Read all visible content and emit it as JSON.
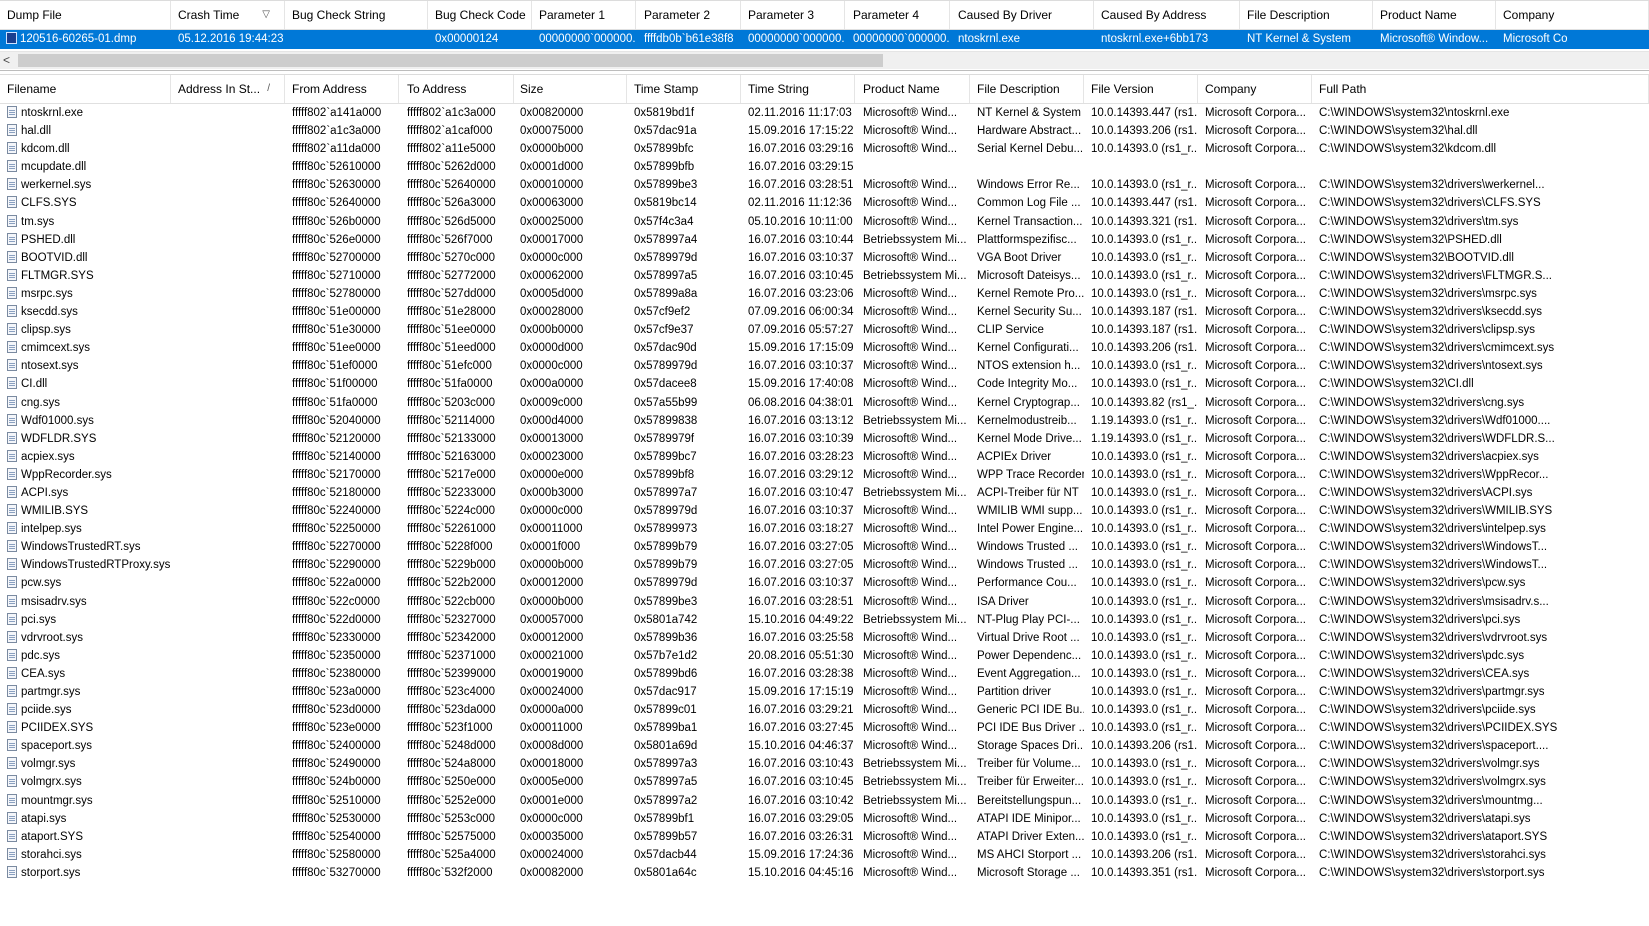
{
  "dump_columns": [
    "Dump File",
    "Crash Time",
    "Bug Check String",
    "Bug Check Code",
    "Parameter 1",
    "Parameter 2",
    "Parameter 3",
    "Parameter 4",
    "Caused By Driver",
    "Caused By Address",
    "File Description",
    "Product Name",
    "Company"
  ],
  "dump_sort_indicator": "▽",
  "dump_row": [
    "120516-60265-01.dmp",
    "05.12.2016 19:44:23",
    "",
    "0x00000124",
    "00000000`000000...",
    "ffffdb0b`b61e38f8",
    "00000000`000000...",
    "00000000`000000...",
    "ntoskrnl.exe",
    "ntoskrnl.exe+6bb173",
    "NT Kernel & System",
    "Microsoft® Window...",
    "Microsoft Co"
  ],
  "scroll_left_arrow": "<",
  "driver_columns": [
    "Filename",
    "Address In St...",
    "From Address",
    "To Address",
    "Size",
    "Time Stamp",
    "Time String",
    "Product Name",
    "File Description",
    "File Version",
    "Company",
    "Full Path"
  ],
  "driver_sort_indicator": "/",
  "drivers": [
    [
      "ntoskrnl.exe",
      "",
      "fffff802`a141a000",
      "fffff802`a1c3a000",
      "0x00820000",
      "0x5819bd1f",
      "02.11.2016 11:17:03",
      "Microsoft® Wind...",
      "NT Kernel & System",
      "10.0.14393.447 (rs1...",
      "Microsoft Corpora...",
      "C:\\WINDOWS\\system32\\ntoskrnl.exe"
    ],
    [
      "hal.dll",
      "",
      "fffff802`a1c3a000",
      "fffff802`a1caf000",
      "0x00075000",
      "0x57dac91a",
      "15.09.2016 17:15:22",
      "Microsoft® Wind...",
      "Hardware Abstract...",
      "10.0.14393.206 (rs1...",
      "Microsoft Corpora...",
      "C:\\WINDOWS\\system32\\hal.dll"
    ],
    [
      "kdcom.dll",
      "",
      "fffff802`a11da000",
      "fffff802`a11e5000",
      "0x0000b000",
      "0x57899bfc",
      "16.07.2016 03:29:16",
      "Microsoft® Wind...",
      "Serial Kernel Debu...",
      "10.0.14393.0 (rs1_r...",
      "Microsoft Corpora...",
      "C:\\WINDOWS\\system32\\kdcom.dll"
    ],
    [
      "mcupdate.dll",
      "",
      "fffff80c`52610000",
      "fffff80c`5262d000",
      "0x0001d000",
      "0x57899bfb",
      "16.07.2016 03:29:15",
      "",
      "",
      "",
      "",
      ""
    ],
    [
      "werkernel.sys",
      "",
      "fffff80c`52630000",
      "fffff80c`52640000",
      "0x00010000",
      "0x57899be3",
      "16.07.2016 03:28:51",
      "Microsoft® Wind...",
      "Windows Error Re...",
      "10.0.14393.0 (rs1_r...",
      "Microsoft Corpora...",
      "C:\\WINDOWS\\system32\\drivers\\werkernel..."
    ],
    [
      "CLFS.SYS",
      "",
      "fffff80c`52640000",
      "fffff80c`526a3000",
      "0x00063000",
      "0x5819bc14",
      "02.11.2016 11:12:36",
      "Microsoft® Wind...",
      "Common Log File ...",
      "10.0.14393.447 (rs1...",
      "Microsoft Corpora...",
      "C:\\WINDOWS\\system32\\drivers\\CLFS.SYS"
    ],
    [
      "tm.sys",
      "",
      "fffff80c`526b0000",
      "fffff80c`526d5000",
      "0x00025000",
      "0x57f4c3a4",
      "05.10.2016 10:11:00",
      "Microsoft® Wind...",
      "Kernel Transaction...",
      "10.0.14393.321 (rs1...",
      "Microsoft Corpora...",
      "C:\\WINDOWS\\system32\\drivers\\tm.sys"
    ],
    [
      "PSHED.dll",
      "",
      "fffff80c`526e0000",
      "fffff80c`526f7000",
      "0x00017000",
      "0x578997a4",
      "16.07.2016 03:10:44",
      "Betriebssystem Mi...",
      "Plattformspezifisc...",
      "10.0.14393.0 (rs1_r...",
      "Microsoft Corpora...",
      "C:\\WINDOWS\\system32\\PSHED.dll"
    ],
    [
      "BOOTVID.dll",
      "",
      "fffff80c`52700000",
      "fffff80c`5270c000",
      "0x0000c000",
      "0x5789979d",
      "16.07.2016 03:10:37",
      "Microsoft® Wind...",
      "VGA Boot Driver",
      "10.0.14393.0 (rs1_r...",
      "Microsoft Corpora...",
      "C:\\WINDOWS\\system32\\BOOTVID.dll"
    ],
    [
      "FLTMGR.SYS",
      "",
      "fffff80c`52710000",
      "fffff80c`52772000",
      "0x00062000",
      "0x578997a5",
      "16.07.2016 03:10:45",
      "Betriebssystem Mi...",
      "Microsoft Dateisys...",
      "10.0.14393.0 (rs1_r...",
      "Microsoft Corpora...",
      "C:\\WINDOWS\\system32\\drivers\\FLTMGR.S..."
    ],
    [
      "msrpc.sys",
      "",
      "fffff80c`52780000",
      "fffff80c`527dd000",
      "0x0005d000",
      "0x57899a8a",
      "16.07.2016 03:23:06",
      "Microsoft® Wind...",
      "Kernel Remote Pro...",
      "10.0.14393.0 (rs1_r...",
      "Microsoft Corpora...",
      "C:\\WINDOWS\\system32\\drivers\\msrpc.sys"
    ],
    [
      "ksecdd.sys",
      "",
      "fffff80c`51e00000",
      "fffff80c`51e28000",
      "0x00028000",
      "0x57cf9ef2",
      "07.09.2016 06:00:34",
      "Microsoft® Wind...",
      "Kernel Security Su...",
      "10.0.14393.187 (rs1...",
      "Microsoft Corpora...",
      "C:\\WINDOWS\\system32\\drivers\\ksecdd.sys"
    ],
    [
      "clipsp.sys",
      "",
      "fffff80c`51e30000",
      "fffff80c`51ee0000",
      "0x000b0000",
      "0x57cf9e37",
      "07.09.2016 05:57:27",
      "Microsoft® Wind...",
      "CLIP Service",
      "10.0.14393.187 (rs1...",
      "Microsoft Corpora...",
      "C:\\WINDOWS\\system32\\drivers\\clipsp.sys"
    ],
    [
      "cmimcext.sys",
      "",
      "fffff80c`51ee0000",
      "fffff80c`51eed000",
      "0x0000d000",
      "0x57dac90d",
      "15.09.2016 17:15:09",
      "Microsoft® Wind...",
      "Kernel Configurati...",
      "10.0.14393.206 (rs1...",
      "Microsoft Corpora...",
      "C:\\WINDOWS\\system32\\drivers\\cmimcext.sys"
    ],
    [
      "ntosext.sys",
      "",
      "fffff80c`51ef0000",
      "fffff80c`51efc000",
      "0x0000c000",
      "0x5789979d",
      "16.07.2016 03:10:37",
      "Microsoft® Wind...",
      "NTOS extension h...",
      "10.0.14393.0 (rs1_r...",
      "Microsoft Corpora...",
      "C:\\WINDOWS\\system32\\drivers\\ntosext.sys"
    ],
    [
      "CI.dll",
      "",
      "fffff80c`51f00000",
      "fffff80c`51fa0000",
      "0x000a0000",
      "0x57dacee8",
      "15.09.2016 17:40:08",
      "Microsoft® Wind...",
      "Code Integrity Mo...",
      "10.0.14393.0 (rs1_r...",
      "Microsoft Corpora...",
      "C:\\WINDOWS\\system32\\CI.dll"
    ],
    [
      "cng.sys",
      "",
      "fffff80c`51fa0000",
      "fffff80c`5203c000",
      "0x0009c000",
      "0x57a55b99",
      "06.08.2016 04:38:01",
      "Microsoft® Wind...",
      "Kernel Cryptograp...",
      "10.0.14393.82 (rs1_...",
      "Microsoft Corpora...",
      "C:\\WINDOWS\\system32\\drivers\\cng.sys"
    ],
    [
      "Wdf01000.sys",
      "",
      "fffff80c`52040000",
      "fffff80c`52114000",
      "0x000d4000",
      "0x57899838",
      "16.07.2016 03:13:12",
      "Betriebssystem Mi...",
      "Kernelmodustreib...",
      "1.19.14393.0 (rs1_r...",
      "Microsoft Corpora...",
      "C:\\WINDOWS\\system32\\drivers\\Wdf01000...."
    ],
    [
      "WDFLDR.SYS",
      "",
      "fffff80c`52120000",
      "fffff80c`52133000",
      "0x00013000",
      "0x5789979f",
      "16.07.2016 03:10:39",
      "Microsoft® Wind...",
      "Kernel Mode Drive...",
      "1.19.14393.0 (rs1_r...",
      "Microsoft Corpora...",
      "C:\\WINDOWS\\system32\\drivers\\WDFLDR.S..."
    ],
    [
      "acpiex.sys",
      "",
      "fffff80c`52140000",
      "fffff80c`52163000",
      "0x00023000",
      "0x57899bc7",
      "16.07.2016 03:28:23",
      "Microsoft® Wind...",
      "ACPIEx Driver",
      "10.0.14393.0 (rs1_r...",
      "Microsoft Corpora...",
      "C:\\WINDOWS\\system32\\drivers\\acpiex.sys"
    ],
    [
      "WppRecorder.sys",
      "",
      "fffff80c`52170000",
      "fffff80c`5217e000",
      "0x0000e000",
      "0x57899bf8",
      "16.07.2016 03:29:12",
      "Microsoft® Wind...",
      "WPP Trace Recorder",
      "10.0.14393.0 (rs1_r...",
      "Microsoft Corpora...",
      "C:\\WINDOWS\\system32\\drivers\\WppRecor..."
    ],
    [
      "ACPI.sys",
      "",
      "fffff80c`52180000",
      "fffff80c`52233000",
      "0x000b3000",
      "0x578997a7",
      "16.07.2016 03:10:47",
      "Betriebssystem Mi...",
      "ACPI-Treiber für NT",
      "10.0.14393.0 (rs1_r...",
      "Microsoft Corpora...",
      "C:\\WINDOWS\\system32\\drivers\\ACPI.sys"
    ],
    [
      "WMILIB.SYS",
      "",
      "fffff80c`52240000",
      "fffff80c`5224c000",
      "0x0000c000",
      "0x5789979d",
      "16.07.2016 03:10:37",
      "Microsoft® Wind...",
      "WMILIB WMI supp...",
      "10.0.14393.0 (rs1_r...",
      "Microsoft Corpora...",
      "C:\\WINDOWS\\system32\\drivers\\WMILIB.SYS"
    ],
    [
      "intelpep.sys",
      "",
      "fffff80c`52250000",
      "fffff80c`52261000",
      "0x00011000",
      "0x57899973",
      "16.07.2016 03:18:27",
      "Microsoft® Wind...",
      "Intel Power Engine...",
      "10.0.14393.0 (rs1_r...",
      "Microsoft Corpora...",
      "C:\\WINDOWS\\system32\\drivers\\intelpep.sys"
    ],
    [
      "WindowsTrustedRT.sys",
      "",
      "fffff80c`52270000",
      "fffff80c`5228f000",
      "0x0001f000",
      "0x57899b79",
      "16.07.2016 03:27:05",
      "Microsoft® Wind...",
      "Windows Trusted ...",
      "10.0.14393.0 (rs1_r...",
      "Microsoft Corpora...",
      "C:\\WINDOWS\\system32\\drivers\\WindowsT..."
    ],
    [
      "WindowsTrustedRTProxy.sys",
      "",
      "fffff80c`52290000",
      "fffff80c`5229b000",
      "0x0000b000",
      "0x57899b79",
      "16.07.2016 03:27:05",
      "Microsoft® Wind...",
      "Windows Trusted ...",
      "10.0.14393.0 (rs1_r...",
      "Microsoft Corpora...",
      "C:\\WINDOWS\\system32\\drivers\\WindowsT..."
    ],
    [
      "pcw.sys",
      "",
      "fffff80c`522a0000",
      "fffff80c`522b2000",
      "0x00012000",
      "0x5789979d",
      "16.07.2016 03:10:37",
      "Microsoft® Wind...",
      "Performance Cou...",
      "10.0.14393.0 (rs1_r...",
      "Microsoft Corpora...",
      "C:\\WINDOWS\\system32\\drivers\\pcw.sys"
    ],
    [
      "msisadrv.sys",
      "",
      "fffff80c`522c0000",
      "fffff80c`522cb000",
      "0x0000b000",
      "0x57899be3",
      "16.07.2016 03:28:51",
      "Microsoft® Wind...",
      "ISA Driver",
      "10.0.14393.0 (rs1_r...",
      "Microsoft Corpora...",
      "C:\\WINDOWS\\system32\\drivers\\msisadrv.s..."
    ],
    [
      "pci.sys",
      "",
      "fffff80c`522d0000",
      "fffff80c`52327000",
      "0x00057000",
      "0x5801a742",
      "15.10.2016 04:49:22",
      "Betriebssystem Mi...",
      "NT-Plug  Play PCI-...",
      "10.0.14393.0 (rs1_r...",
      "Microsoft Corpora...",
      "C:\\WINDOWS\\system32\\drivers\\pci.sys"
    ],
    [
      "vdrvroot.sys",
      "",
      "fffff80c`52330000",
      "fffff80c`52342000",
      "0x00012000",
      "0x57899b36",
      "16.07.2016 03:25:58",
      "Microsoft® Wind...",
      "Virtual Drive Root ...",
      "10.0.14393.0 (rs1_r...",
      "Microsoft Corpora...",
      "C:\\WINDOWS\\system32\\drivers\\vdrvroot.sys"
    ],
    [
      "pdc.sys",
      "",
      "fffff80c`52350000",
      "fffff80c`52371000",
      "0x00021000",
      "0x57b7e1d2",
      "20.08.2016 05:51:30",
      "Microsoft® Wind...",
      "Power Dependenc...",
      "10.0.14393.0 (rs1_r...",
      "Microsoft Corpora...",
      "C:\\WINDOWS\\system32\\drivers\\pdc.sys"
    ],
    [
      "CEA.sys",
      "",
      "fffff80c`52380000",
      "fffff80c`52399000",
      "0x00019000",
      "0x57899bd6",
      "16.07.2016 03:28:38",
      "Microsoft® Wind...",
      "Event Aggregation...",
      "10.0.14393.0 (rs1_r...",
      "Microsoft Corpora...",
      "C:\\WINDOWS\\system32\\drivers\\CEA.sys"
    ],
    [
      "partmgr.sys",
      "",
      "fffff80c`523a0000",
      "fffff80c`523c4000",
      "0x00024000",
      "0x57dac917",
      "15.09.2016 17:15:19",
      "Microsoft® Wind...",
      "Partition driver",
      "10.0.14393.0 (rs1_r...",
      "Microsoft Corpora...",
      "C:\\WINDOWS\\system32\\drivers\\partmgr.sys"
    ],
    [
      "pciide.sys",
      "",
      "fffff80c`523d0000",
      "fffff80c`523da000",
      "0x0000a000",
      "0x57899c01",
      "16.07.2016 03:29:21",
      "Microsoft® Wind...",
      "Generic PCI IDE Bu...",
      "10.0.14393.0 (rs1_r...",
      "Microsoft Corpora...",
      "C:\\WINDOWS\\system32\\drivers\\pciide.sys"
    ],
    [
      "PCIIDEX.SYS",
      "",
      "fffff80c`523e0000",
      "fffff80c`523f1000",
      "0x00011000",
      "0x57899ba1",
      "16.07.2016 03:27:45",
      "Microsoft® Wind...",
      "PCI IDE Bus Driver ...",
      "10.0.14393.0 (rs1_r...",
      "Microsoft Corpora...",
      "C:\\WINDOWS\\system32\\drivers\\PCIIDEX.SYS"
    ],
    [
      "spaceport.sys",
      "",
      "fffff80c`52400000",
      "fffff80c`5248d000",
      "0x0008d000",
      "0x5801a69d",
      "15.10.2016 04:46:37",
      "Microsoft® Wind...",
      "Storage Spaces Dri...",
      "10.0.14393.206 (rs1...",
      "Microsoft Corpora...",
      "C:\\WINDOWS\\system32\\drivers\\spaceport...."
    ],
    [
      "volmgr.sys",
      "",
      "fffff80c`52490000",
      "fffff80c`524a8000",
      "0x00018000",
      "0x578997a3",
      "16.07.2016 03:10:43",
      "Betriebssystem Mi...",
      "Treiber für Volume...",
      "10.0.14393.0 (rs1_r...",
      "Microsoft Corpora...",
      "C:\\WINDOWS\\system32\\drivers\\volmgr.sys"
    ],
    [
      "volmgrx.sys",
      "",
      "fffff80c`524b0000",
      "fffff80c`5250e000",
      "0x0005e000",
      "0x578997a5",
      "16.07.2016 03:10:45",
      "Betriebssystem Mi...",
      "Treiber für Erweiter...",
      "10.0.14393.0 (rs1_r...",
      "Microsoft Corpora...",
      "C:\\WINDOWS\\system32\\drivers\\volmgrx.sys"
    ],
    [
      "mountmgr.sys",
      "",
      "fffff80c`52510000",
      "fffff80c`5252e000",
      "0x0001e000",
      "0x578997a2",
      "16.07.2016 03:10:42",
      "Betriebssystem Mi...",
      "Bereitstellungspun...",
      "10.0.14393.0 (rs1_r...",
      "Microsoft Corpora...",
      "C:\\WINDOWS\\system32\\drivers\\mountmg..."
    ],
    [
      "atapi.sys",
      "",
      "fffff80c`52530000",
      "fffff80c`5253c000",
      "0x0000c000",
      "0x57899bf1",
      "16.07.2016 03:29:05",
      "Microsoft® Wind...",
      "ATAPI IDE Minipor...",
      "10.0.14393.0 (rs1_r...",
      "Microsoft Corpora...",
      "C:\\WINDOWS\\system32\\drivers\\atapi.sys"
    ],
    [
      "ataport.SYS",
      "",
      "fffff80c`52540000",
      "fffff80c`52575000",
      "0x00035000",
      "0x57899b57",
      "16.07.2016 03:26:31",
      "Microsoft® Wind...",
      "ATAPI Driver Exten...",
      "10.0.14393.0 (rs1_r...",
      "Microsoft Corpora...",
      "C:\\WINDOWS\\system32\\drivers\\ataport.SYS"
    ],
    [
      "storahci.sys",
      "",
      "fffff80c`52580000",
      "fffff80c`525a4000",
      "0x00024000",
      "0x57dacb44",
      "15.09.2016 17:24:36",
      "Microsoft® Wind...",
      "MS AHCI Storport ...",
      "10.0.14393.206 (rs1...",
      "Microsoft Corpora...",
      "C:\\WINDOWS\\system32\\drivers\\storahci.sys"
    ],
    [
      "storport.sys",
      "",
      "fffff80c`53270000",
      "fffff80c`532f2000",
      "0x00082000",
      "0x5801a64c",
      "15.10.2016 04:45:16",
      "Microsoft® Wind...",
      "Microsoft Storage ...",
      "10.0.14393.351 (rs1...",
      "Microsoft Corpora...",
      "C:\\WINDOWS\\system32\\drivers\\storport.sys"
    ]
  ]
}
